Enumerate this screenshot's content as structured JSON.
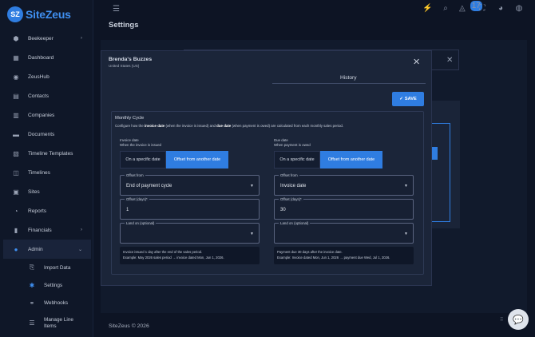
{
  "app": {
    "brand_logo": "SZ",
    "brand_name": "SiteZeus"
  },
  "sidebar": {
    "items": [
      {
        "label": "Beekeeper",
        "icon": "beekeeper-icon",
        "chevron": "›"
      },
      {
        "label": "Dashboard",
        "icon": "dashboard-icon"
      },
      {
        "label": "ZeusHub",
        "icon": "zeushub-icon"
      },
      {
        "label": "Contacts",
        "icon": "contacts-icon"
      },
      {
        "label": "Companies",
        "icon": "companies-icon"
      },
      {
        "label": "Documents",
        "icon": "documents-icon"
      },
      {
        "label": "Timeline Templates",
        "icon": "timeline-templates-icon"
      },
      {
        "label": "Timelines",
        "icon": "timelines-icon"
      },
      {
        "label": "Sites",
        "icon": "sites-icon"
      },
      {
        "label": "Reports",
        "icon": "reports-icon"
      },
      {
        "label": "Financials",
        "icon": "financials-icon",
        "chevron": "›"
      },
      {
        "label": "Admin",
        "icon": "admin-icon",
        "chevron": "⌄"
      }
    ],
    "admin_sub": [
      {
        "label": "Import Data",
        "icon": "import-icon"
      },
      {
        "label": "Settings",
        "icon": "gear-icon"
      },
      {
        "label": "Webhooks",
        "icon": "webhook-icon"
      },
      {
        "label": "Manage Line Items",
        "icon": "list-icon"
      }
    ]
  },
  "topbar": {
    "notification_count": "17"
  },
  "page": {
    "title": "Settings",
    "footer": "SiteZeus © 2026"
  },
  "modal": {
    "title": "Brenda's Buzzes",
    "subtitle": "United States (US)",
    "tab_active": "History",
    "save_label": "SAVE",
    "section_title": "Monthly Cycle",
    "desc_pre": "Configure how the ",
    "desc_b1": "invoice date",
    "desc_mid": " (when the invoice is issued) and ",
    "desc_b2": "due date",
    "desc_post": " (when payment is owed) are calculated from each monthly sales period.",
    "invoice": {
      "label": "Invoice date",
      "sub": "When the invoice is issued",
      "toggle_off": "On a specific date",
      "toggle_on": "Offset from another date",
      "offset_from_label": "Offset from",
      "offset_from_value": "End of payment cycle",
      "offset_days_label": "Offset (days)*",
      "offset_days_value": "1",
      "land_on_label": "Land on (optional)",
      "note_line1": "Invoice issued 1 day after the end of the sales period.",
      "note_line2": "Example: May 2026 sales period → invoice dated Mon, Jun 1, 2026."
    },
    "due": {
      "label": "Due date",
      "sub": "When payment is owed",
      "toggle_off": "On a specific date",
      "toggle_on": "Offset from another date",
      "offset_from_label": "Offset from",
      "offset_from_value": "Invoice date",
      "offset_days_label": "Offset (days)*",
      "offset_days_value": "30",
      "land_on_label": "Land on (optional)",
      "note_line1": "Payment due 30 days after the invoice date.",
      "note_line2": "Example: Invoice dated Mon, Jun 1, 2026 → payment due Wed, Jul 1, 2026."
    }
  },
  "colors": {
    "accent": "#2f7de1",
    "bg": "#0d1424",
    "modal": "#1b2539"
  }
}
